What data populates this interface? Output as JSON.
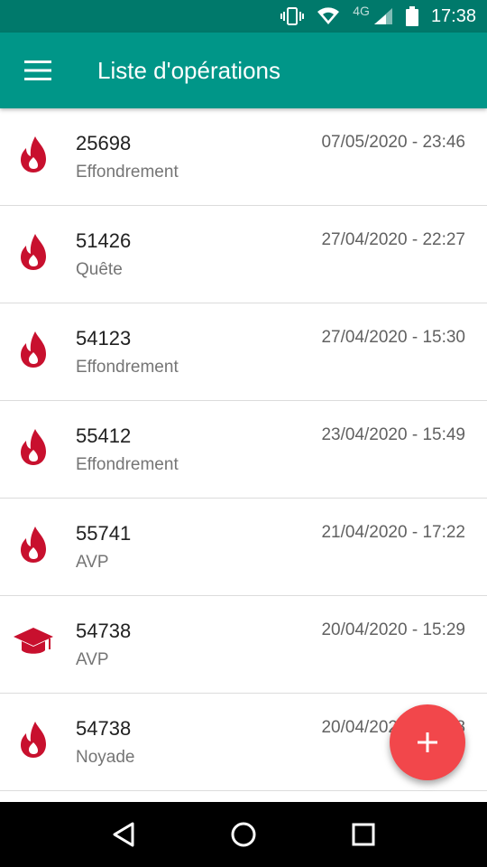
{
  "status_bar": {
    "network": "4G",
    "time": "17:38",
    "icons": [
      "vibrate-icon",
      "wifi-icon",
      "signal-icon",
      "battery-icon"
    ]
  },
  "app_bar": {
    "title": "Liste d'opérations",
    "menu_icon": "menu-icon"
  },
  "colors": {
    "status_bar": "#00796b",
    "app_bar": "#009688",
    "icon_red": "#c8102e",
    "fab": "#f2474b"
  },
  "operations": [
    {
      "number": "25698",
      "category": "Effondrement",
      "date": "07/05/2020 - 23:46",
      "icon": "flame-icon"
    },
    {
      "number": "51426",
      "category": "Quête",
      "date": "27/04/2020 - 22:27",
      "icon": "flame-icon"
    },
    {
      "number": "54123",
      "category": "Effondrement",
      "date": "27/04/2020 - 15:30",
      "icon": "flame-icon"
    },
    {
      "number": "55412",
      "category": "Effondrement",
      "date": "23/04/2020 - 15:49",
      "icon": "flame-icon"
    },
    {
      "number": "55741",
      "category": "AVP",
      "date": "21/04/2020 - 17:22",
      "icon": "flame-icon"
    },
    {
      "number": "54738",
      "category": "AVP",
      "date": "20/04/2020 - 15:29",
      "icon": "graduation-cap-icon"
    },
    {
      "number": "54738",
      "category": "Noyade",
      "date": "20/04/2020 - 15:28",
      "icon": "flame-icon"
    }
  ],
  "fab": {
    "icon": "plus-icon"
  },
  "nav_bar": {
    "icons": [
      "back-icon",
      "home-icon",
      "recents-icon"
    ]
  }
}
